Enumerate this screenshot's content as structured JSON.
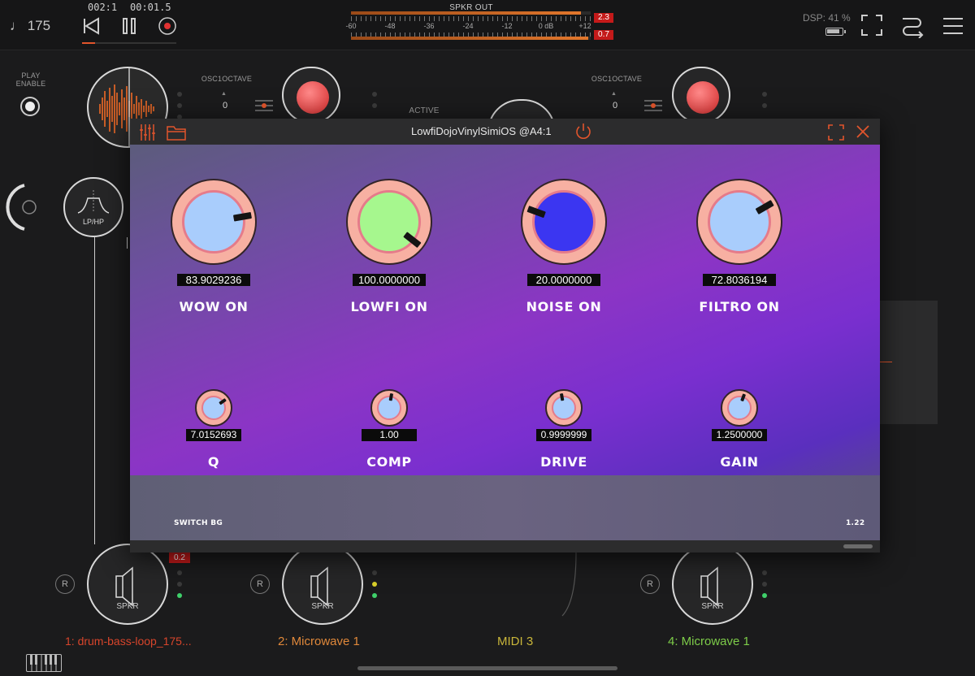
{
  "transport": {
    "tempo": "♩ 175",
    "bar_time": "002:1",
    "clock_time": "00:01.5",
    "progress": 0.14
  },
  "meter": {
    "title": "SPKR OUT",
    "scale": [
      "-60",
      "-48",
      "-36",
      "-24",
      "-12",
      "0 dB",
      "+12"
    ],
    "level_top": 0.96,
    "level_bottom": 0.99,
    "peak_top": "2.3",
    "peak_bottom": "0.7"
  },
  "status": {
    "dsp": "DSP: 41 %"
  },
  "workspace": {
    "play_enable_label": "PLAY\nENABLE",
    "osc_label_1": "OSC1OCTAVE",
    "osc_label_2": "OSC1OCTAVE",
    "osc_value_1": "0",
    "osc_value_2": "0",
    "active_label": "ACTIVE",
    "filter_label": "LP/HP",
    "clip_badge": "0.2",
    "speakers": [
      {
        "label": "SPKR",
        "record": "R"
      },
      {
        "label": "SPKR",
        "record": "R"
      },
      {
        "label": "SPKR",
        "record": "R"
      }
    ],
    "tracks": [
      {
        "name": "1: drum-bass-loop_175...",
        "color": "#d8452b"
      },
      {
        "name": "2: Microwave 1",
        "color": "#e0883a"
      },
      {
        "name": "MIDI 3",
        "color": "#c9b63a"
      },
      {
        "name": "4: Microwave 1",
        "color": "#7dcc49"
      }
    ]
  },
  "plugin": {
    "title": "LowfiDojoVinylSimiOS @A4:1",
    "knobs_large": [
      {
        "value": "83.9029236",
        "label": "WOW ON",
        "color": "#a9cdfc"
      },
      {
        "value": "100.0000000",
        "label": "LOWFI ON",
        "color": "#a6f78e"
      },
      {
        "value": "20.0000000",
        "label": "NOISE ON",
        "color": "#3b36f1"
      },
      {
        "value": "72.8036194",
        "label": "FILTRO ON",
        "color": "#a9cdfc"
      }
    ],
    "knobs_small": [
      {
        "value": "7.0152693",
        "label": "Q",
        "color": "#a9cdfc"
      },
      {
        "value": "1.00",
        "label": "COMP",
        "color": "#a9cdfc"
      },
      {
        "value": "0.9999999",
        "label": "DRIVE",
        "color": "#a9cdfc"
      },
      {
        "value": "1.2500000",
        "label": "GAIN",
        "color": "#a9cdfc"
      }
    ],
    "switch_bg_label": "SWITCH BG",
    "version": "1.22"
  },
  "colors": {
    "accent": "#e2552c",
    "knob_ring": "#f7b0a2",
    "knob_rim": "#e57b8a"
  }
}
